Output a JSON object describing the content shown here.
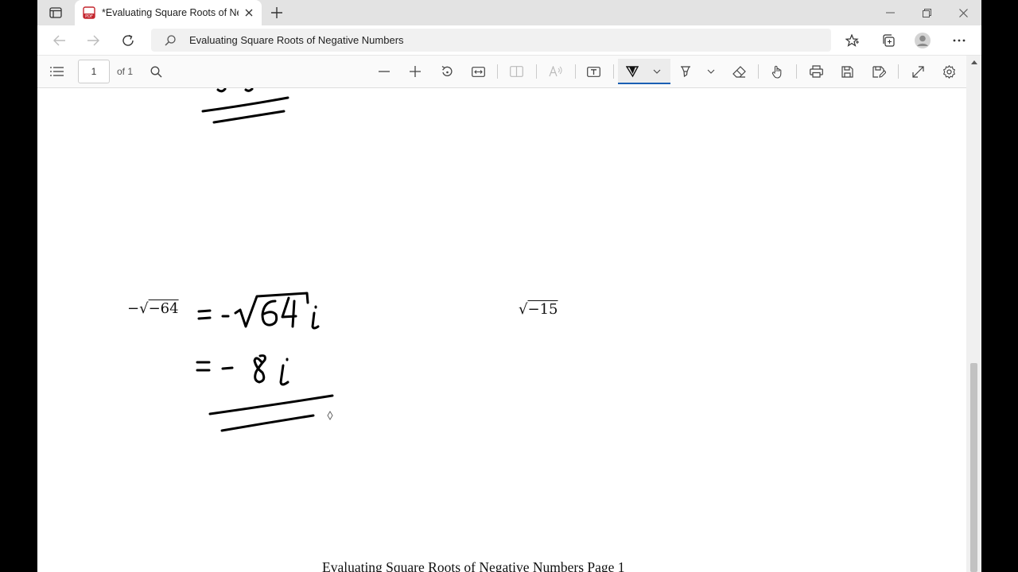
{
  "browser": {
    "tab": {
      "title": "*Evaluating Square Roots of Negative Numbers",
      "favicon": "pdf-icon"
    },
    "address_bar": {
      "url": "Evaluating Square Roots of Negative Numbers"
    }
  },
  "pdf_toolbar": {
    "page_number": "1",
    "page_total": "of 1",
    "active_tool": "draw"
  },
  "document": {
    "problem1": {
      "minus": "−",
      "radical": "√",
      "radicand": "−64"
    },
    "problem2": {
      "radical": "√",
      "radicand": "−15"
    },
    "handwritten": [
      "= -√64 i",
      "= -8i"
    ],
    "footer": "Evaluating Square Roots of Negative Numbers Page 1"
  },
  "colors": {
    "accent": "#1a5fb4",
    "ink": "#000000"
  }
}
